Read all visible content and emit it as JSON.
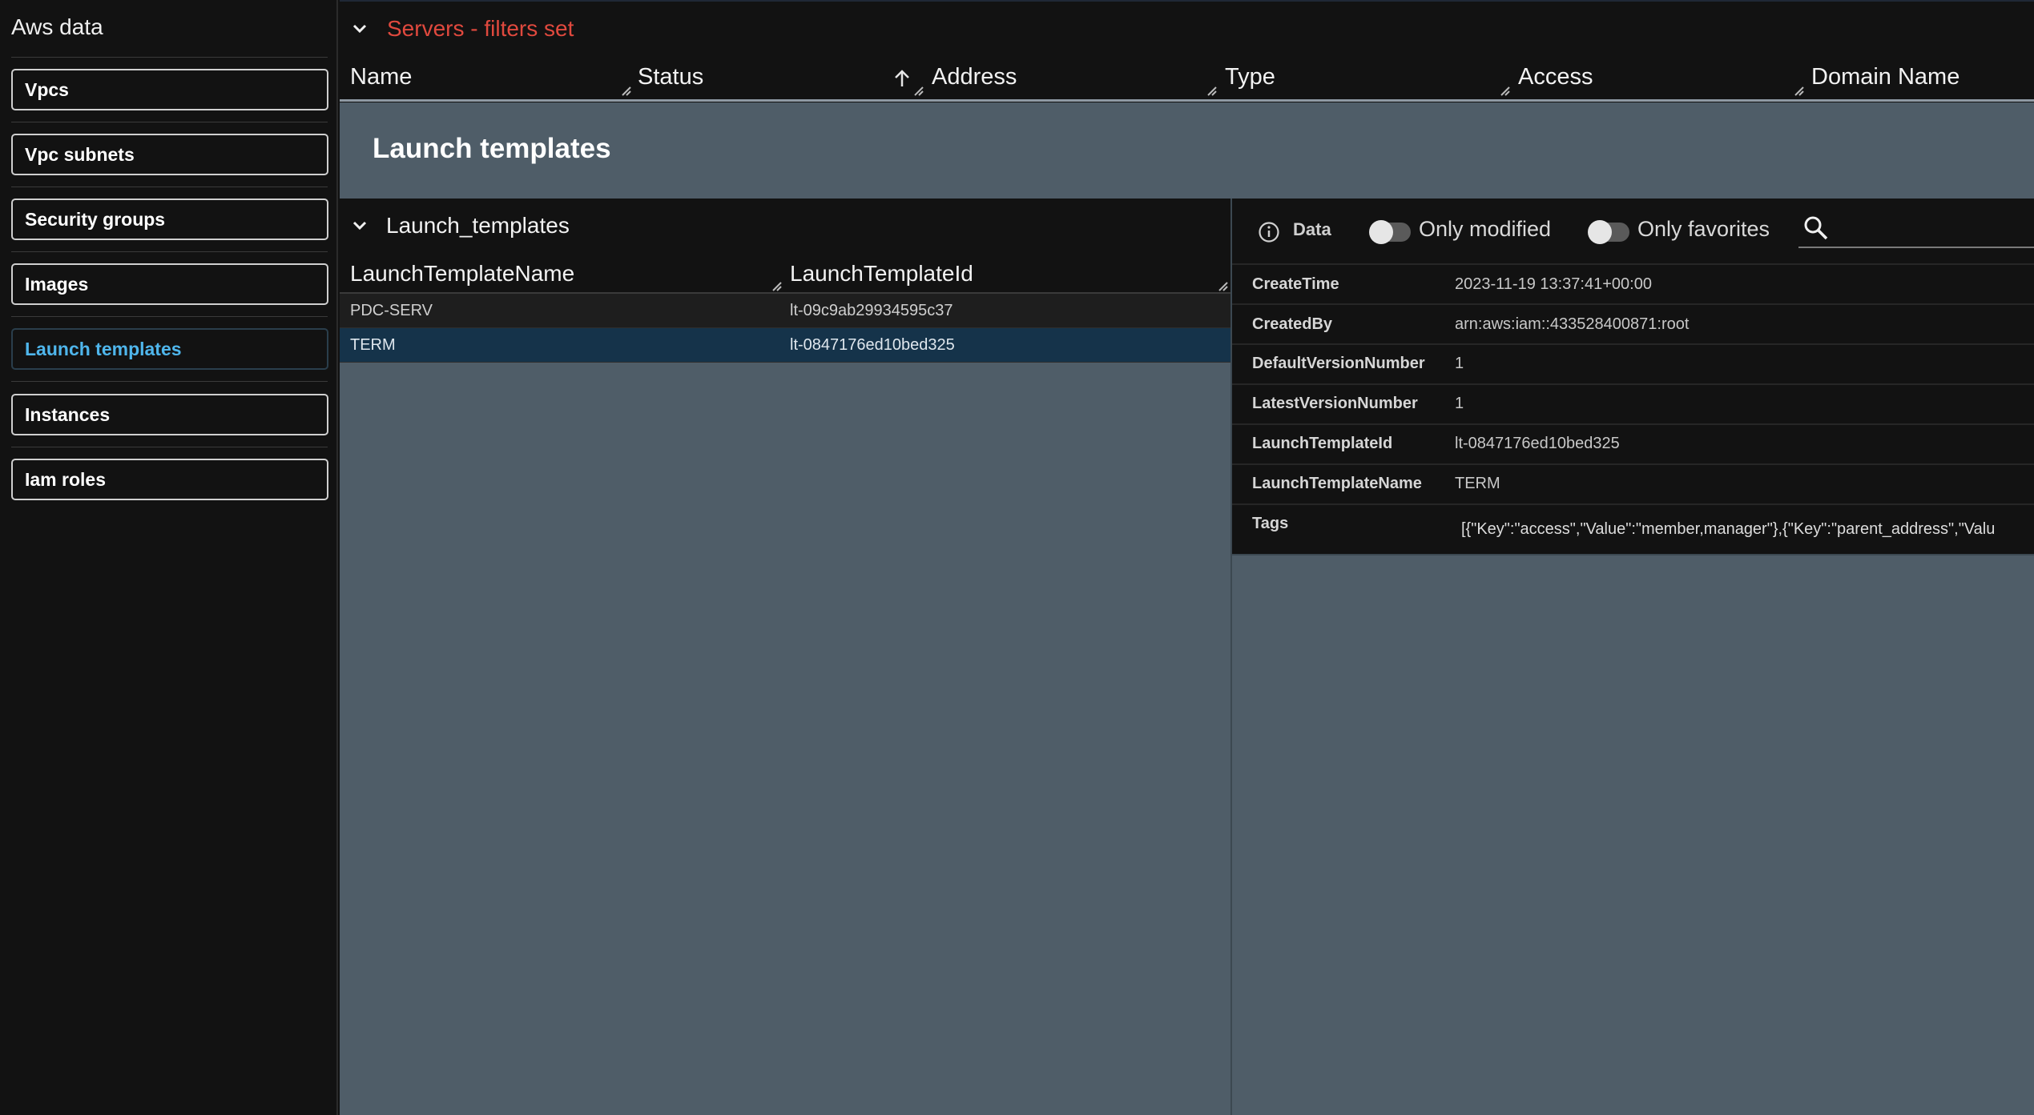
{
  "sidebar": {
    "title": "Aws data",
    "items": [
      {
        "label": "Vpcs"
      },
      {
        "label": "Vpc subnets"
      },
      {
        "label": "Security groups"
      },
      {
        "label": "Images"
      },
      {
        "label": "Launch templates"
      },
      {
        "label": "Instances"
      },
      {
        "label": "Iam roles"
      }
    ]
  },
  "servers": {
    "title": "Servers - filters set",
    "columns": [
      "Name",
      "Status",
      "Address",
      "Type",
      "Access",
      "Domain Name"
    ]
  },
  "page": {
    "title": "Launch templates"
  },
  "launch_table": {
    "title": "Launch_templates",
    "columns": [
      "LaunchTemplateName",
      "LaunchTemplateId"
    ],
    "rows": [
      {
        "name": "PDC-SERV",
        "id": "lt-09c9ab29934595c37"
      },
      {
        "name": "TERM",
        "id": "lt-0847176ed10bed325"
      }
    ]
  },
  "detail": {
    "data_label": "Data",
    "only_modified": "Only modified",
    "only_favorites": "Only favorites",
    "fields": [
      {
        "key": "CreateTime",
        "value": "2023-11-19 13:37:41+00:00"
      },
      {
        "key": "CreatedBy",
        "value": "arn:aws:iam::433528400871:root"
      },
      {
        "key": "DefaultVersionNumber",
        "value": "1"
      },
      {
        "key": "LatestVersionNumber",
        "value": "1"
      },
      {
        "key": "LaunchTemplateId",
        "value": "lt-0847176ed10bed325"
      },
      {
        "key": "LaunchTemplateName",
        "value": "TERM"
      },
      {
        "key": "Tags",
        "value": "[{\"Key\":\"access\",\"Value\":\"member,manager\"},{\"Key\":\"parent_address\",\"Valu"
      }
    ]
  },
  "colors": {
    "accent_red": "#e0493e",
    "accent_blue": "#4fb6ec",
    "panel_slate": "#4f5d68",
    "selected_row": "#15334a"
  },
  "icons": [
    "chevron-down-icon",
    "sort-ascending-icon",
    "info-icon",
    "search-icon",
    "resize-grip-icon"
  ]
}
